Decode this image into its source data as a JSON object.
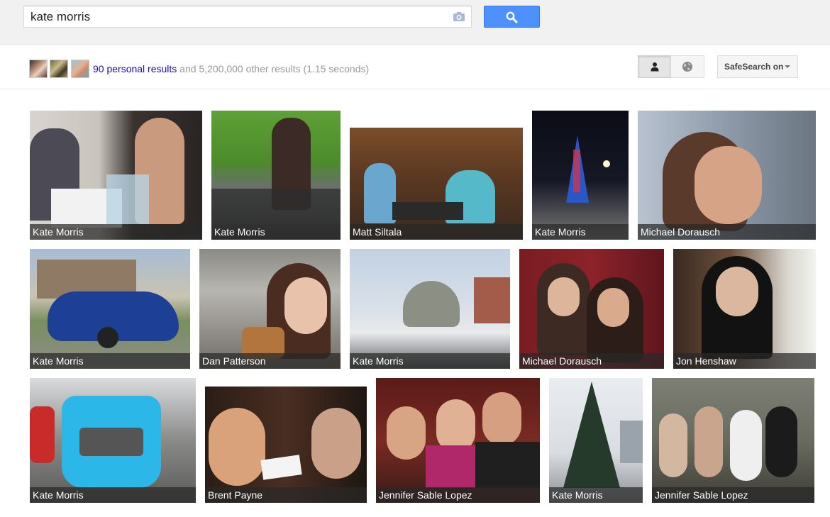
{
  "search": {
    "query": "kate morris",
    "camera_icon": "camera-icon",
    "button_icon": "magnifier-icon"
  },
  "stats": {
    "personal_link": "90 personal results",
    "rest": " and 5,200,000 other results (1.15 seconds)"
  },
  "toggles": {
    "personal_icon": "person-icon",
    "world_icon": "globe-icon"
  },
  "safesearch": {
    "label": "SafeSearch on"
  },
  "colors": {
    "accent": "#4d90fe",
    "link": "#1a0dab"
  },
  "images": [
    {
      "caption": "Kate Morris"
    },
    {
      "caption": "Kate Morris"
    },
    {
      "caption": "Matt Siltala"
    },
    {
      "caption": "Kate Morris"
    },
    {
      "caption": "Michael Dorausch"
    },
    {
      "caption": "Kate Morris"
    },
    {
      "caption": "Dan Patterson"
    },
    {
      "caption": "Kate Morris"
    },
    {
      "caption": "Michael Dorausch"
    },
    {
      "caption": "Jon Henshaw"
    },
    {
      "caption": "Kate Morris"
    },
    {
      "caption": "Brent Payne"
    },
    {
      "caption": "Jennifer Sable Lopez"
    },
    {
      "caption": "Kate Morris"
    },
    {
      "caption": "Jennifer Sable Lopez"
    }
  ]
}
